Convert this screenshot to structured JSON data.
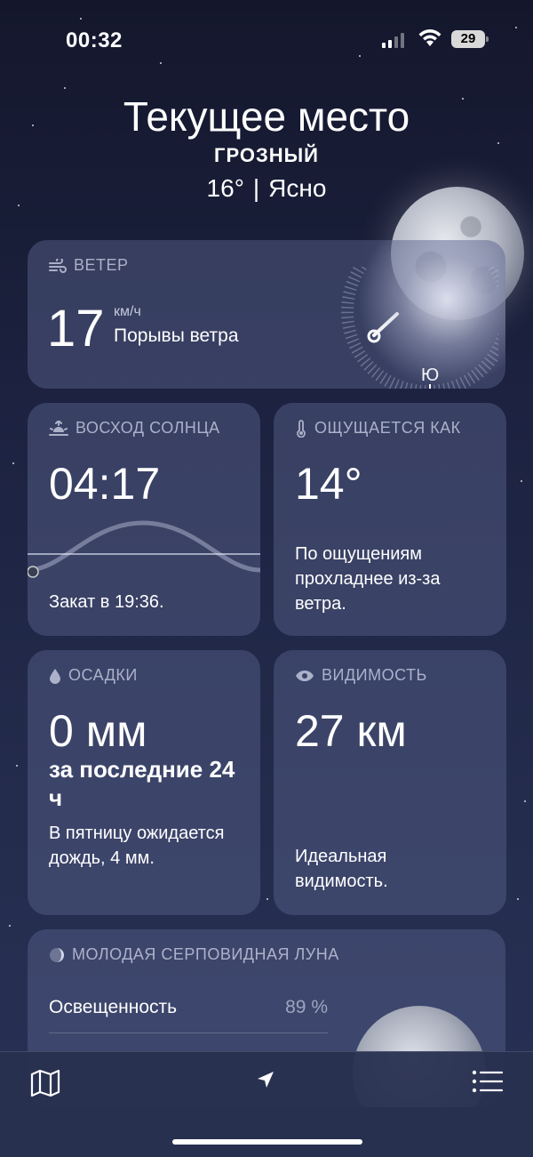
{
  "status": {
    "time": "00:32",
    "battery": "29"
  },
  "header": {
    "title": "Текущее место",
    "city": "ГРОЗНЫЙ",
    "temp": "16°",
    "condition": "Ясно"
  },
  "wind": {
    "label": "ВЕТЕР",
    "speed": "17",
    "unit": "км/ч",
    "desc": "Порывы ветра",
    "compass_south": "Ю"
  },
  "sunrise": {
    "label": "ВОСХОД СОЛНЦА",
    "time": "04:17",
    "sunset": "Закат в 19:36."
  },
  "feels_like": {
    "label": "ОЩУЩАЕТСЯ КАК",
    "value": "14°",
    "desc": "По ощущениям прохладнее из-за ветра."
  },
  "precipitation": {
    "label": "ОСАДКИ",
    "value": "0 мм",
    "period": "за последние 24 ч",
    "forecast": "В пятницу ожидается дождь, 4 мм."
  },
  "visibility": {
    "label": "ВИДИМОСТЬ",
    "value": "27 км",
    "desc": "Идеальная видимость."
  },
  "moon": {
    "label": "МОЛОДАЯ СЕРПОВИДНАЯ ЛУНА",
    "row_label": "Освещенность",
    "row_value": "89 %"
  },
  "tabbar": {
    "map_icon": "map-icon",
    "location_icon": "location-arrow-icon",
    "list_icon": "list-icon"
  }
}
